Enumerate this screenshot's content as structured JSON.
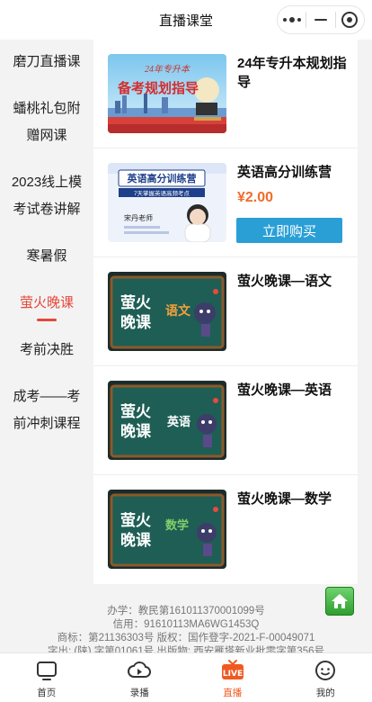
{
  "header": {
    "title": "直播课堂"
  },
  "sidebar": {
    "items": [
      {
        "lines": [
          "磨刀直播课"
        ]
      },
      {
        "lines": [
          "蟠桃礼包附",
          "赠网课"
        ]
      },
      {
        "lines": [
          "2023线上模",
          "考试卷讲解"
        ]
      },
      {
        "lines": [
          "寒暑假"
        ]
      },
      {
        "lines": [
          "萤火晚课"
        ],
        "active": true
      },
      {
        "lines": [
          "考前决胜"
        ]
      },
      {
        "lines": [
          "成考——考",
          "前冲刺课程"
        ]
      }
    ]
  },
  "courses": [
    {
      "name": "24年专升本规划指导",
      "thumb_text": [
        "24年专升本",
        "备考规划指导"
      ]
    },
    {
      "name": "英语高分训练营",
      "price": "¥2.00",
      "buy_label": "立即购买",
      "thumb_text": [
        "英语高分训练营",
        "7天掌握英语高频考点",
        "宋丹老师"
      ]
    },
    {
      "name": "萤火晚课—语文",
      "thumb_text": [
        "萤火",
        "晚课",
        "语文"
      ]
    },
    {
      "name": "萤火晚课—英语",
      "thumb_text": [
        "萤火",
        "晚课",
        "英语"
      ]
    },
    {
      "name": "萤火晚课—数学",
      "thumb_text": [
        "萤火",
        "晚课",
        "数学"
      ]
    }
  ],
  "footer": {
    "lines": [
      "办学：教民第161011370001099号",
      "信用：91610113MA6WG1453Q",
      "商标：第21136303号 版权：国作登字-2021-F-00049071",
      "字出: (陕) 字第01061号 出版物: 西安雁塔新业批零字第356号"
    ]
  },
  "tabbar": {
    "items": [
      {
        "label": "首页",
        "icon": "tv-icon"
      },
      {
        "label": "录播",
        "icon": "cloud-play-icon"
      },
      {
        "label": "直播",
        "icon": "live-icon",
        "active": true
      },
      {
        "label": "我的",
        "icon": "user-face-icon"
      }
    ]
  },
  "colors": {
    "accent": "#e5483a",
    "buy": "#2a9fd6",
    "price": "#f06b2a",
    "live": "#f05a22",
    "board": "#1e5e55"
  }
}
